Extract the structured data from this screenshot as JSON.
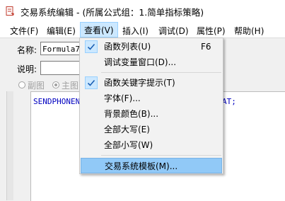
{
  "window": {
    "title": "交易系统编辑 - (所属公式组：1.简单指标策略)"
  },
  "menubar": {
    "items": [
      {
        "label": "文件(F)"
      },
      {
        "label": "编辑(E)"
      },
      {
        "label": "查看(V)"
      },
      {
        "label": "插入(I)"
      },
      {
        "label": "调试(D)"
      },
      {
        "label": "属性(P)"
      },
      {
        "label": "帮助(H)"
      }
    ]
  },
  "form": {
    "name_label": "名称:",
    "name_value": "Formula7",
    "desc_label": "说明:",
    "desc_value": "",
    "radio_subchart": "副图",
    "radio_mainchart": "主图"
  },
  "editor": {
    "code_visible": "SENDPHONEN",
    "code_tail": "AT;"
  },
  "view_menu": {
    "items": [
      {
        "label": "函数列表(U)",
        "shortcut": "F6",
        "checked": true
      },
      {
        "label": "调试变量窗口(D)...",
        "shortcut": "",
        "checked": false
      },
      {
        "label": "函数关键字提示(T)",
        "shortcut": "",
        "checked": true
      },
      {
        "label": "字体(F)...",
        "shortcut": "",
        "checked": false
      },
      {
        "label": "背景颜色(B)...",
        "shortcut": "",
        "checked": false
      },
      {
        "label": "全部大写(E)",
        "shortcut": "",
        "checked": false
      },
      {
        "label": "全部小写(W)",
        "shortcut": "",
        "checked": false
      },
      {
        "label": "交易系统模板(M)...",
        "shortcut": "",
        "checked": false,
        "hovered": true
      }
    ]
  },
  "colors": {
    "accent": "#cce8ff",
    "hover": "#91c9f7",
    "code": "#0000c0",
    "app_icon": "#c0392b"
  }
}
